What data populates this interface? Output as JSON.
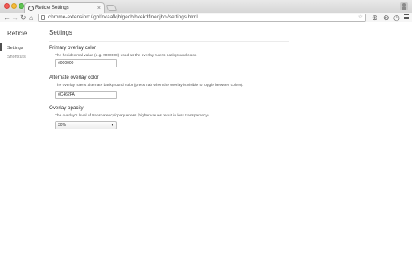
{
  "browser": {
    "tab_title": "Reticle Settings",
    "tab_close": "×",
    "url": "chrome-extension://gblfnkaafkjhlgeobjhkekdflnedjhoi/settings.html",
    "nav_back": "←",
    "nav_forward": "→",
    "nav_reload": "↻",
    "nav_home": "⌂",
    "star": "☆",
    "ext_icons": [
      "⊕",
      "⊛",
      "◷"
    ]
  },
  "sidebar": {
    "title": "Reticle",
    "items": [
      {
        "label": "Settings",
        "selected": true
      },
      {
        "label": "Shortcuts",
        "selected": false
      }
    ]
  },
  "main": {
    "title": "Settings",
    "sections": [
      {
        "heading": "Primary overlay color",
        "description": "The hexidecimal value (e.g. #000000) used as the overlay ruler's background color.",
        "value": "#000000"
      },
      {
        "heading": "Alternate overlay color",
        "description": "The overlay ruler's alternate background color (press Tab when the overlay is visible to toggle between colors).",
        "value": "#C462FA"
      },
      {
        "heading": "Overlay opacity",
        "description": "The overlay's level of transparency/opaqueness (higher values result in less transparency).",
        "value": "30%",
        "arrow": "▾"
      }
    ]
  },
  "colors": {
    "accent": "#505050",
    "close_button": "#f25a55",
    "minimize_button": "#f6bb3a",
    "zoom_button": "#60c453"
  }
}
